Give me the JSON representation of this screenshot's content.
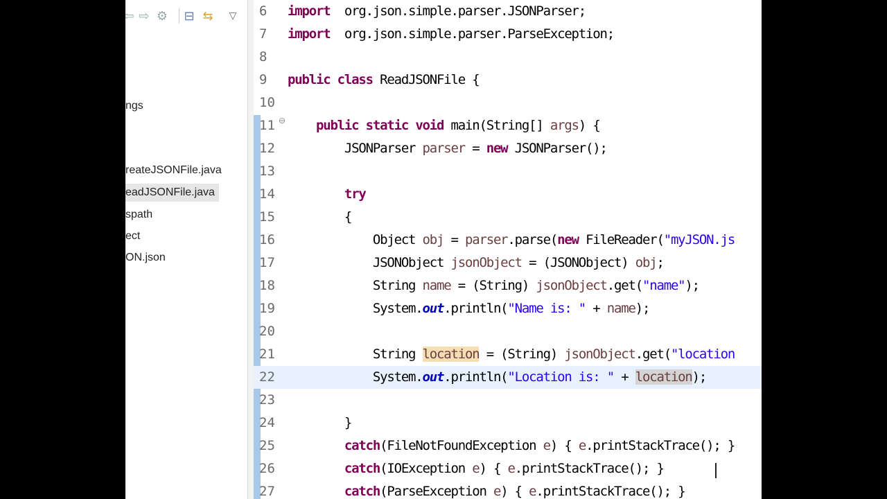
{
  "explorer": {
    "items": [
      {
        "label": "ngs",
        "selected": false
      },
      {
        "label": "reateJSONFile.java",
        "selected": false
      },
      {
        "label": "eadJSONFile.java",
        "selected": true
      },
      {
        "label": "spath",
        "selected": false
      },
      {
        "label": "ect",
        "selected": false
      },
      {
        "label": "ON.json",
        "selected": false
      }
    ],
    "toolbar_icons": [
      "back-icon",
      "forward-icon",
      "settings-icon",
      "collapse-all-icon",
      "link-with-editor-icon",
      "view-menu-icon"
    ]
  },
  "editor": {
    "lines": [
      {
        "n": "6",
        "tokens": [
          [
            "kw",
            "import"
          ],
          [
            "",
            "  org.json.simple.parser.JSONParser;"
          ]
        ]
      },
      {
        "n": "7",
        "tokens": [
          [
            "kw",
            "import"
          ],
          [
            "",
            "  org.json.simple.parser.ParseException;"
          ]
        ]
      },
      {
        "n": "8",
        "tokens": []
      },
      {
        "n": "9",
        "tokens": [
          [
            "kw",
            "public class"
          ],
          [
            "",
            " ReadJSONFile {"
          ]
        ]
      },
      {
        "n": "10",
        "tokens": []
      },
      {
        "n": "11",
        "tokens": [
          [
            "",
            "    "
          ],
          [
            "kw",
            "public static void"
          ],
          [
            "",
            " main(String[] "
          ],
          [
            "var",
            "args"
          ],
          [
            "",
            ") {"
          ]
        ],
        "fold": true
      },
      {
        "n": "12",
        "tokens": [
          [
            "",
            "        JSONParser "
          ],
          [
            "var",
            "parser"
          ],
          [
            "",
            " = "
          ],
          [
            "kw",
            "new"
          ],
          [
            "",
            " JSONParser();"
          ]
        ]
      },
      {
        "n": "13",
        "tokens": []
      },
      {
        "n": "14",
        "tokens": [
          [
            "",
            "        "
          ],
          [
            "kw",
            "try"
          ]
        ]
      },
      {
        "n": "15",
        "tokens": [
          [
            "",
            "        {"
          ]
        ]
      },
      {
        "n": "16",
        "tokens": [
          [
            "",
            "            Object "
          ],
          [
            "var",
            "obj"
          ],
          [
            "",
            " = "
          ],
          [
            "var",
            "parser"
          ],
          [
            "",
            ".parse("
          ],
          [
            "kw",
            "new"
          ],
          [
            "",
            " FileReader("
          ],
          [
            "str",
            "\"myJSON.js"
          ]
        ]
      },
      {
        "n": "17",
        "tokens": [
          [
            "",
            "            JSONObject "
          ],
          [
            "var",
            "jsonObject"
          ],
          [
            "",
            " = (JSONObject) "
          ],
          [
            "var",
            "obj"
          ],
          [
            "",
            ";"
          ]
        ]
      },
      {
        "n": "18",
        "tokens": [
          [
            "",
            "            String "
          ],
          [
            "var",
            "name"
          ],
          [
            "",
            " = (String) "
          ],
          [
            "var",
            "jsonObject"
          ],
          [
            "",
            ".get("
          ],
          [
            "str",
            "\"name\""
          ],
          [
            "",
            ");"
          ]
        ]
      },
      {
        "n": "19",
        "tokens": [
          [
            "",
            "            System."
          ],
          [
            "fld",
            "out"
          ],
          [
            "",
            ".println("
          ],
          [
            "str",
            "\"Name is: \""
          ],
          [
            "",
            " + "
          ],
          [
            "var",
            "name"
          ],
          [
            "",
            ");"
          ]
        ]
      },
      {
        "n": "20",
        "tokens": []
      },
      {
        "n": "21",
        "tokens": [
          [
            "",
            "            String "
          ],
          [
            "var hl-write",
            "location"
          ],
          [
            "",
            " = (String) "
          ],
          [
            "var",
            "jsonObject"
          ],
          [
            "",
            ".get("
          ],
          [
            "str",
            "\"location"
          ]
        ]
      },
      {
        "n": "22",
        "tokens": [
          [
            "",
            "            System."
          ],
          [
            "fld",
            "out"
          ],
          [
            "",
            ".println("
          ],
          [
            "str",
            "\"Location is: \""
          ],
          [
            "",
            " + "
          ],
          [
            "var hl-read",
            "location"
          ],
          [
            "",
            ");"
          ]
        ],
        "current": true
      },
      {
        "n": "23",
        "tokens": []
      },
      {
        "n": "24",
        "tokens": [
          [
            "",
            "        }"
          ]
        ]
      },
      {
        "n": "25",
        "tokens": [
          [
            "",
            "        "
          ],
          [
            "kw",
            "catch"
          ],
          [
            "",
            "(FileNotFoundException "
          ],
          [
            "var",
            "e"
          ],
          [
            "",
            ") { "
          ],
          [
            "var",
            "e"
          ],
          [
            "",
            ".printStackTrace(); }"
          ]
        ]
      },
      {
        "n": "26",
        "tokens": [
          [
            "",
            "        "
          ],
          [
            "kw",
            "catch"
          ],
          [
            "",
            "(IOException "
          ],
          [
            "var",
            "e"
          ],
          [
            "",
            ") { "
          ],
          [
            "var",
            "e"
          ],
          [
            "",
            ".printStackTrace(); }"
          ]
        ]
      },
      {
        "n": "27",
        "tokens": [
          [
            "",
            "        "
          ],
          [
            "kw",
            "catch"
          ],
          [
            "",
            "(ParseException "
          ],
          [
            "var",
            "e"
          ],
          [
            "",
            ") { "
          ],
          [
            "var",
            "e"
          ],
          [
            "",
            ".printStackTrace(); }"
          ]
        ]
      }
    ]
  }
}
